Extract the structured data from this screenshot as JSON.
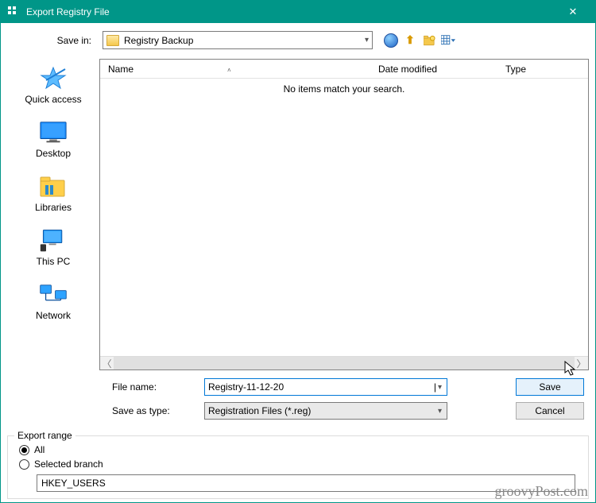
{
  "window": {
    "title": "Export Registry File"
  },
  "savein": {
    "label": "Save in:",
    "folder": "Registry Backup"
  },
  "nav_icons": {
    "back": "back-icon",
    "up": "up-one-level-icon",
    "newfolder": "new-folder-icon",
    "views": "views-menu-icon"
  },
  "places": [
    {
      "key": "quick-access",
      "label": "Quick access"
    },
    {
      "key": "desktop",
      "label": "Desktop"
    },
    {
      "key": "libraries",
      "label": "Libraries"
    },
    {
      "key": "this-pc",
      "label": "This PC"
    },
    {
      "key": "network",
      "label": "Network"
    }
  ],
  "columns": {
    "name": "Name",
    "date": "Date modified",
    "type": "Type"
  },
  "empty_message": "No items match your search.",
  "fields": {
    "file_name_label": "File name:",
    "file_name_value": "Registry-11-12-20",
    "save_as_type_label": "Save as type:",
    "save_as_type_value": "Registration Files (*.reg)"
  },
  "buttons": {
    "save": "Save",
    "cancel": "Cancel"
  },
  "export_range": {
    "legend": "Export range",
    "opt_all": "All",
    "opt_selected": "Selected branch",
    "branch_value": "HKEY_USERS",
    "selected": "all"
  },
  "watermark": "groovyPost.com"
}
